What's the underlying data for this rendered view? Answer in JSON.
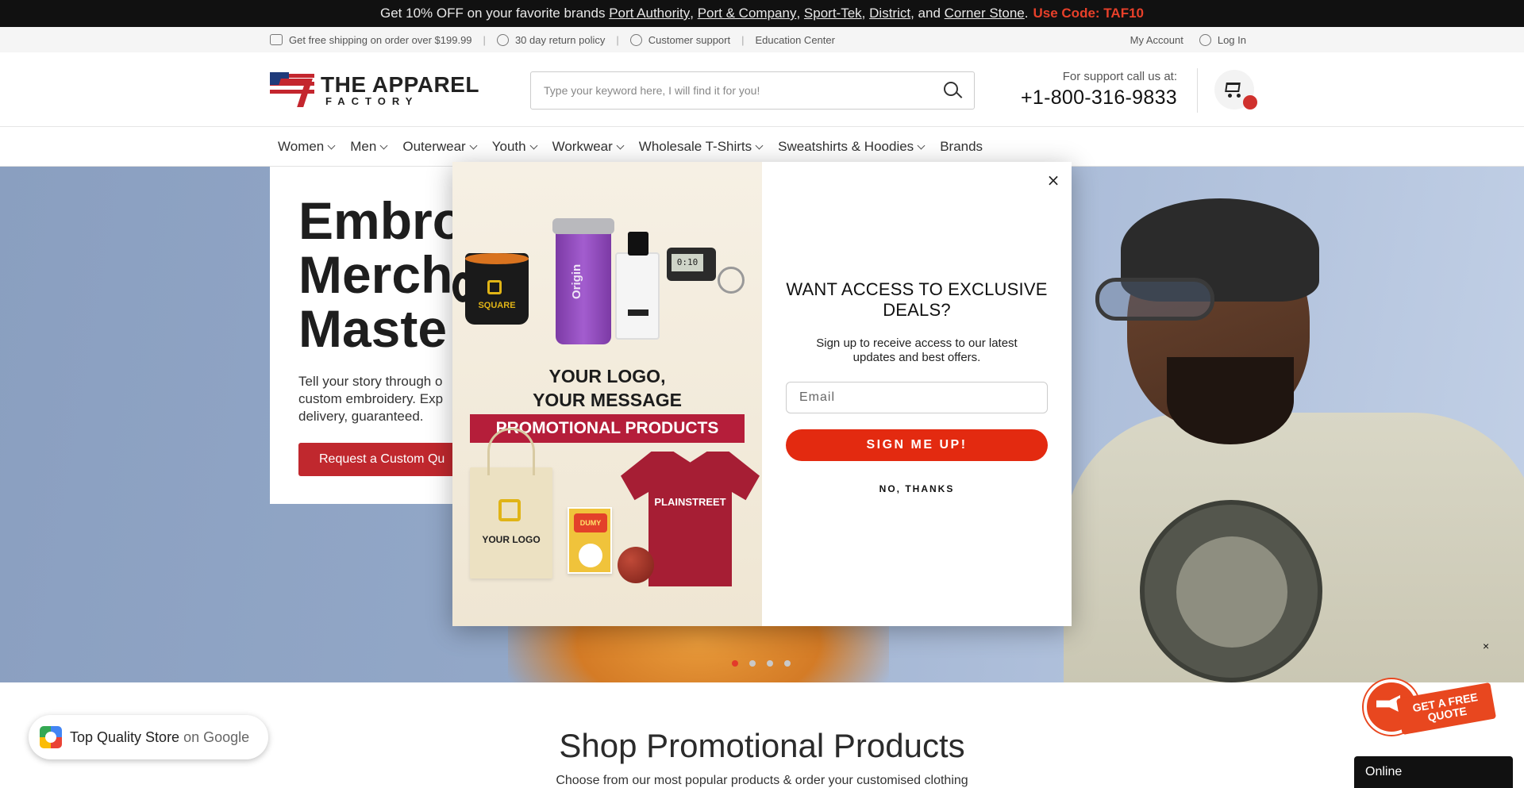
{
  "announcement": {
    "prefix": "Get 10% OFF on your favorite brands",
    "brands": [
      "Port Authority",
      "Port & Company",
      "Sport-Tek",
      "District",
      "Corner Stone"
    ],
    "sep_comma": ",",
    "sep_and": ", and",
    "period": ".",
    "code_label": "Use Code: TAF10",
    "code_color": "#e8402a"
  },
  "topbar": {
    "shipping": "Get free shipping on order over $199.99",
    "returns": "30 day return policy",
    "support": "Customer support",
    "education": "Education Center",
    "separator": "|",
    "account": "My Account",
    "login": "Log In"
  },
  "header": {
    "logo_line1": "THE APPAREL",
    "logo_line2": "FACTORY",
    "search_placeholder": "Type your keyword here, I will find it for you!",
    "support_label": "For support call us at:",
    "phone": "+1-800-316-9833"
  },
  "nav": {
    "items": [
      {
        "label": "Women",
        "has_dropdown": true
      },
      {
        "label": "Men",
        "has_dropdown": true
      },
      {
        "label": "Outerwear",
        "has_dropdown": true
      },
      {
        "label": "Youth",
        "has_dropdown": true
      },
      {
        "label": "Workwear",
        "has_dropdown": true
      },
      {
        "label": "Wholesale T-Shirts",
        "has_dropdown": true
      },
      {
        "label": "Sweatshirts & Hoodies",
        "has_dropdown": true
      },
      {
        "label": "Brands",
        "has_dropdown": false
      }
    ]
  },
  "hero": {
    "heading_line1": "Embro",
    "heading_line2": "Merch",
    "heading_line3": "Maste",
    "body_line1": "Tell your story through o",
    "body_line2": "custom embroidery. Exp",
    "body_line3": "delivery, guaranteed.",
    "cta": "Request a Custom Qu",
    "slides": 4,
    "active_slide": 1,
    "close_glyph": "×"
  },
  "modal": {
    "heading": "WANT ACCESS TO EXCLUSIVE DEALS?",
    "subtext": "Sign up to receive access to our latest updates and best offers.",
    "email_placeholder": "Email",
    "submit": "SIGN ME UP!",
    "decline": "NO, THANKS",
    "close_glyph": "×",
    "accent_color": "#e32a10",
    "image": {
      "mug_text": "SQUARE",
      "tumbler_text": "Origin",
      "keychain_time": "0:10",
      "title_line1": "YOUR LOGO,",
      "title_line2": "YOUR MESSAGE",
      "ribbon": "PROMOTIONAL PRODUCTS",
      "tote_text": "YOUR LOGO",
      "comic_text": "DUMY",
      "tee_text": "PLAINSTREET"
    }
  },
  "section": {
    "title": "Shop Promotional Products",
    "subtitle": "Choose from our most popular products & order your customised clothing"
  },
  "google_badge": {
    "text": "Top Quality Store",
    "suffix": "on Google"
  },
  "quote_widget": {
    "line1": "GET A FREE",
    "line2": "QUOTE"
  },
  "chat": {
    "status": "Online"
  }
}
